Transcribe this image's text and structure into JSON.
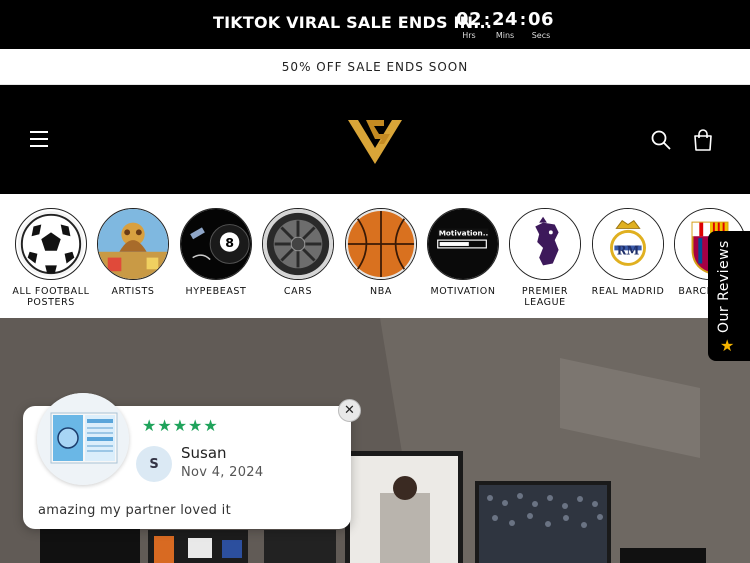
{
  "countdown": {
    "title": "TIKTOK VIRAL SALE ENDS IN...",
    "hours": "02",
    "minutes": "24",
    "seconds": "06",
    "hours_label": "Hrs",
    "minutes_label": "Mins",
    "seconds_label": "Secs",
    "separator": ":"
  },
  "announcement": {
    "text": "50% OFF SALE ENDS SOON"
  },
  "header": {
    "menu_icon": "hamburger-menu-icon",
    "logo_icon": "vg-logo",
    "search_icon": "search-icon",
    "cart_icon": "cart-icon"
  },
  "categories": [
    {
      "label": "ALL FOOTBALL POSTERS",
      "icon": "football-icon"
    },
    {
      "label": "ARTISTS",
      "icon": "artist-album-icon"
    },
    {
      "label": "HYPEBEAST",
      "icon": "eight-ball-icon"
    },
    {
      "label": "CARS",
      "icon": "car-wheel-icon"
    },
    {
      "label": "NBA",
      "icon": "basketball-icon"
    },
    {
      "label": "MOTIVATION",
      "icon": "motivation-loading-icon"
    },
    {
      "label": "PREMIER LEAGUE",
      "icon": "premier-league-lion-icon"
    },
    {
      "label": "REAL MADRID",
      "icon": "real-madrid-crest-icon"
    },
    {
      "label": "BARCELONA",
      "icon": "barcelona-crest-icon"
    }
  ],
  "review": {
    "stars": "★★★★★",
    "avatar_initial": "S",
    "reviewer": "Susan",
    "date": "Nov 4, 2024",
    "text": "amazing my partner loved it",
    "close": "✕"
  },
  "reviews_tab": {
    "label": "Our Reviews",
    "star": "★"
  },
  "colors": {
    "black": "#000000",
    "star_green": "#1fa35b",
    "tab_star": "#f5b400",
    "logo_gold": "#d9a538"
  }
}
